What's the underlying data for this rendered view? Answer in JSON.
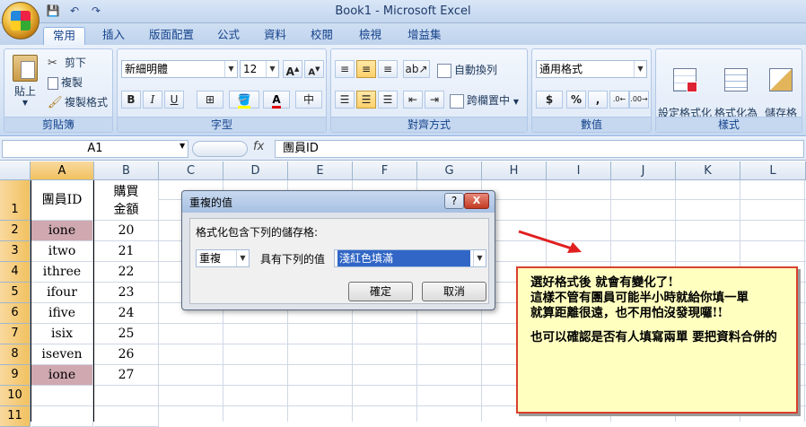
{
  "window": {
    "title": "Book1 - Microsoft Excel"
  },
  "qat": {
    "save": "💾",
    "undo": "↶",
    "redo": "↷"
  },
  "tabs": [
    "常用",
    "插入",
    "版面配置",
    "公式",
    "資料",
    "校閱",
    "檢視",
    "增益集"
  ],
  "ribbon": {
    "clipboard": {
      "label": "剪貼簿",
      "paste": "貼上",
      "cut": "剪下",
      "copy": "複製",
      "format_painter": "複製格式"
    },
    "font": {
      "label": "字型",
      "font_name": "新細明體",
      "font_size": "12",
      "bold": "B",
      "italic": "I",
      "underline": "U",
      "grow": "A",
      "shrink": "A",
      "font_color": "A"
    },
    "alignment": {
      "label": "對齊方式",
      "wrap": "自動換列",
      "merge": "跨欄置中"
    },
    "number": {
      "label": "數值",
      "format": "通用格式",
      "currency": "$",
      "percent": "%",
      "comma": ","
    },
    "styles": {
      "label": "樣式",
      "conditional": "設定格式化\n的條件",
      "table": "格式化為\n表格",
      "cell_styles": "儲存格\n樣式"
    }
  },
  "formula_bar": {
    "name_box": "A1",
    "fx": "fx",
    "content": "團員ID"
  },
  "columns": [
    "A",
    "B",
    "C",
    "D",
    "E",
    "F",
    "G",
    "H",
    "I",
    "J",
    "K",
    "L"
  ],
  "rows": [
    "1",
    "2",
    "3",
    "4",
    "5",
    "6",
    "7",
    "8",
    "9",
    "10",
    "11"
  ],
  "cells": {
    "A1": "團員ID",
    "B1a": "購買",
    "B1b": "金額",
    "A": [
      "ione",
      "itwo",
      "ithree",
      "ifour",
      "ifive",
      "isix",
      "iseven",
      "ione"
    ],
    "B": [
      "20",
      "21",
      "22",
      "23",
      "24",
      "25",
      "26",
      "27"
    ]
  },
  "dialog": {
    "title": "重複的值",
    "help": "?",
    "close": "X",
    "prompt": "格式化包含下列的儲存格:",
    "type_value": "重複",
    "middle_label": "具有下列的值",
    "format_value": "淺紅色填滿",
    "ok": "確定",
    "cancel": "取消"
  },
  "note": {
    "line1": "選好格式後 就會有變化了!",
    "line2": "這樣不管有團員可能半小時就給你填一單",
    "line3": "就算距離很遠，也不用怕沒發現囉!!",
    "line4": "也可以確認是否有人填寫兩單 要把資料合併的"
  },
  "colors": {
    "duplicate_fill": "#cfa8b0",
    "arrow": "#e02020",
    "note_border": "#d84030",
    "note_bg": "#ffffc0"
  }
}
